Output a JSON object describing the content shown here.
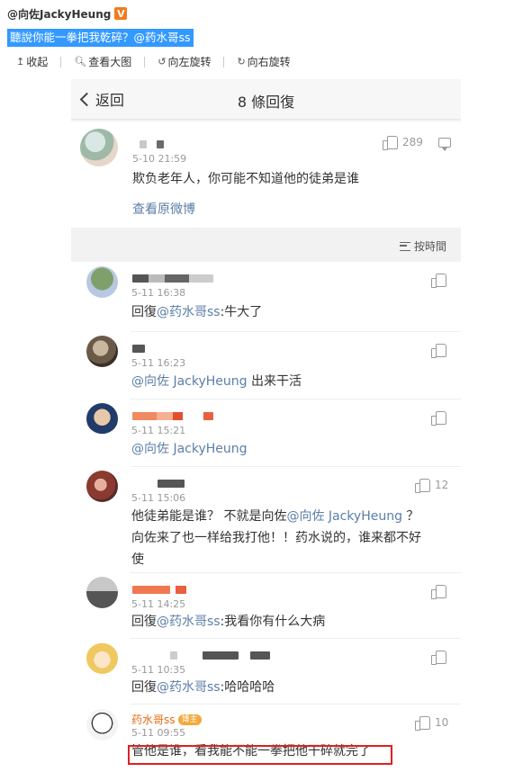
{
  "post": {
    "author": "@向佐JackyHeung",
    "verified_badge": "V",
    "text": "聽說你能一拳把我乾碎？@药水哥ss"
  },
  "toolbar": {
    "collapse": "收起",
    "view_large": "查看大图",
    "rotate_left": "向左旋转",
    "rotate_right": "向右旋转"
  },
  "screenshot": {
    "nav": {
      "back_label": "返回",
      "title": "8 條回復"
    },
    "original_comment": {
      "time": "5-10 21:59",
      "likes": "289",
      "text": "欺负老年人，你可能不知道他的徒弟是谁",
      "view_original": "查看原微博"
    },
    "sort_label": "按時間",
    "replies": [
      {
        "time": "5-11 16:38",
        "text_prefix": "回復",
        "mention": "@药水哥ss",
        "text_suffix": ":牛大了",
        "likes": ""
      },
      {
        "time": "5-11 16:23",
        "text_prefix": "",
        "mention": "@向佐 JackyHeung",
        "text_suffix": " 出来干活",
        "likes": ""
      },
      {
        "time": "5-11 15:21",
        "text_prefix": "",
        "mention": "@向佐 JackyHeung",
        "text_suffix": "",
        "likes": ""
      },
      {
        "time": "5-11 15:06",
        "text_line1_prefix": "他徒弟能是谁？ 不就是向佐",
        "mention": "@向佐 JackyHeung",
        "text_line1_suffix": " ？",
        "text_line2": "向佐来了也一样给我打他！！药水说的，谁来都不好",
        "text_line3": "使",
        "likes": "12"
      },
      {
        "time": "5-11 14:25",
        "text_prefix": "回復",
        "mention": "@药水哥ss",
        "text_suffix": ":我看你有什么大病",
        "likes": ""
      },
      {
        "time": "5-11 10:35",
        "text_prefix": "回復",
        "mention": "@药水哥ss",
        "text_suffix": ":哈哈哈哈",
        "likes": ""
      },
      {
        "name": "药水哥ss",
        "fan_badge": "博主",
        "time": "5-11 09:55",
        "text": "管他是谁，看我能不能一拳把他干碎就完了",
        "likes": "10"
      }
    ]
  }
}
